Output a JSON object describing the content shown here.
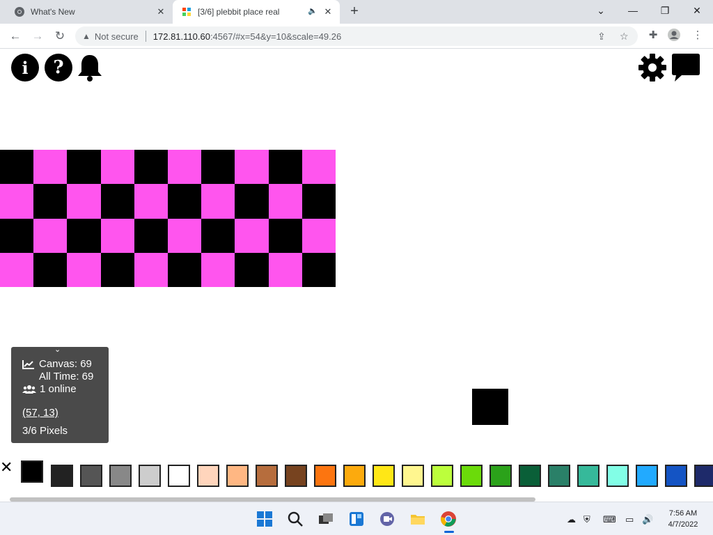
{
  "browser": {
    "tabs": [
      {
        "title": "What's New"
      },
      {
        "title": "[3/6] plebbit place real"
      }
    ],
    "url": {
      "security_label": "Not secure",
      "host": "172.81.110.60",
      "rest": ":4567/#x=54&y=10&scale=49.26"
    }
  },
  "stats": {
    "canvas": "Canvas: 69",
    "all_time": "All Time: 69",
    "online": "1 online",
    "coords": "(57, 13)",
    "pixels": "3/6 Pixels"
  },
  "grid": {
    "rows": 4,
    "cols": 10,
    "colors": [
      "#000000",
      "#ff55ee"
    ],
    "pattern": [
      [
        0,
        1,
        0,
        1,
        0,
        1,
        0,
        1,
        0,
        1
      ],
      [
        1,
        0,
        1,
        0,
        1,
        0,
        1,
        0,
        1,
        0
      ],
      [
        0,
        1,
        0,
        1,
        0,
        1,
        0,
        1,
        0,
        1
      ],
      [
        1,
        0,
        1,
        0,
        1,
        0,
        1,
        0,
        1,
        0
      ]
    ]
  },
  "palette": {
    "selected": "#000000",
    "swatches": [
      "#222222",
      "#555555",
      "#888888",
      "#cdcdcd",
      "#ffffff",
      "#ffd5bc",
      "#ffb783",
      "#b66d3d",
      "#77431f",
      "#fc7510",
      "#fcaa0d",
      "#ffe716",
      "#fff68f",
      "#bcfe3c",
      "#6bdb0a",
      "#2ba21a",
      "#0a5f38",
      "#2a8068",
      "#36b99a",
      "#82fee6",
      "#22aaff",
      "#1454c4",
      "#1e2a6a"
    ]
  },
  "taskbar": {
    "time": "7:56 AM",
    "date": "4/7/2022"
  }
}
